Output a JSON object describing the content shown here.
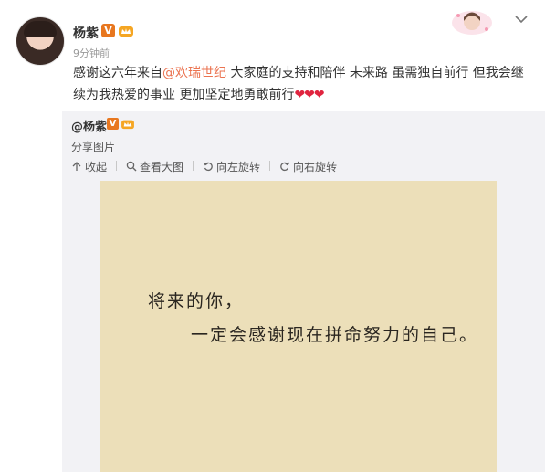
{
  "post": {
    "user_name": "杨紫",
    "verified_badge": "V",
    "timestamp": "9分钟前",
    "text_prefix": "感谢这六年来自",
    "mention": "@欢瑞世纪",
    "text_suffix": " 大家庭的支持和陪伴 未来路 虽需独自前行 但我会继续为我热爱的事业 更加坚定地勇敢前行",
    "hearts": "❤❤❤"
  },
  "repost": {
    "user": "@杨紫",
    "verified_badge": "V",
    "description": "分享图片",
    "toolbar": {
      "collapse": "收起",
      "view_large": "查看大图",
      "rotate_left": "向左旋转",
      "rotate_right": "向右旋转"
    },
    "quote_line1": "将来的你，",
    "quote_line2": "一定会感谢现在拼命努力的自己。"
  },
  "colors": {
    "mention": "#eb7350",
    "badge": "#e8771f",
    "repost_bg": "#f2f2f5",
    "image_bg": "#ecdfb9",
    "heart": "#e0243f"
  },
  "icons": [
    "verified-icon",
    "vip-crown-icon",
    "chat-avatar-icon",
    "chevron-down-icon",
    "collapse-icon",
    "zoom-icon",
    "rotate-left-icon",
    "rotate-right-icon"
  ]
}
